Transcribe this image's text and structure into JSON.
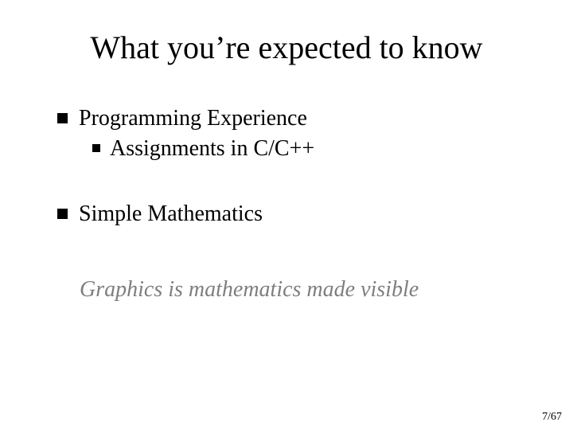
{
  "title": "What you’re expected to know",
  "bullets": {
    "item1": {
      "label": "Programming Experience",
      "sub1": "Assignments in C/C++"
    },
    "item2": {
      "label": "Simple Mathematics"
    }
  },
  "quote": "Graphics is mathematics made visible",
  "page": {
    "current": "7",
    "separator": "/",
    "total": "67"
  }
}
